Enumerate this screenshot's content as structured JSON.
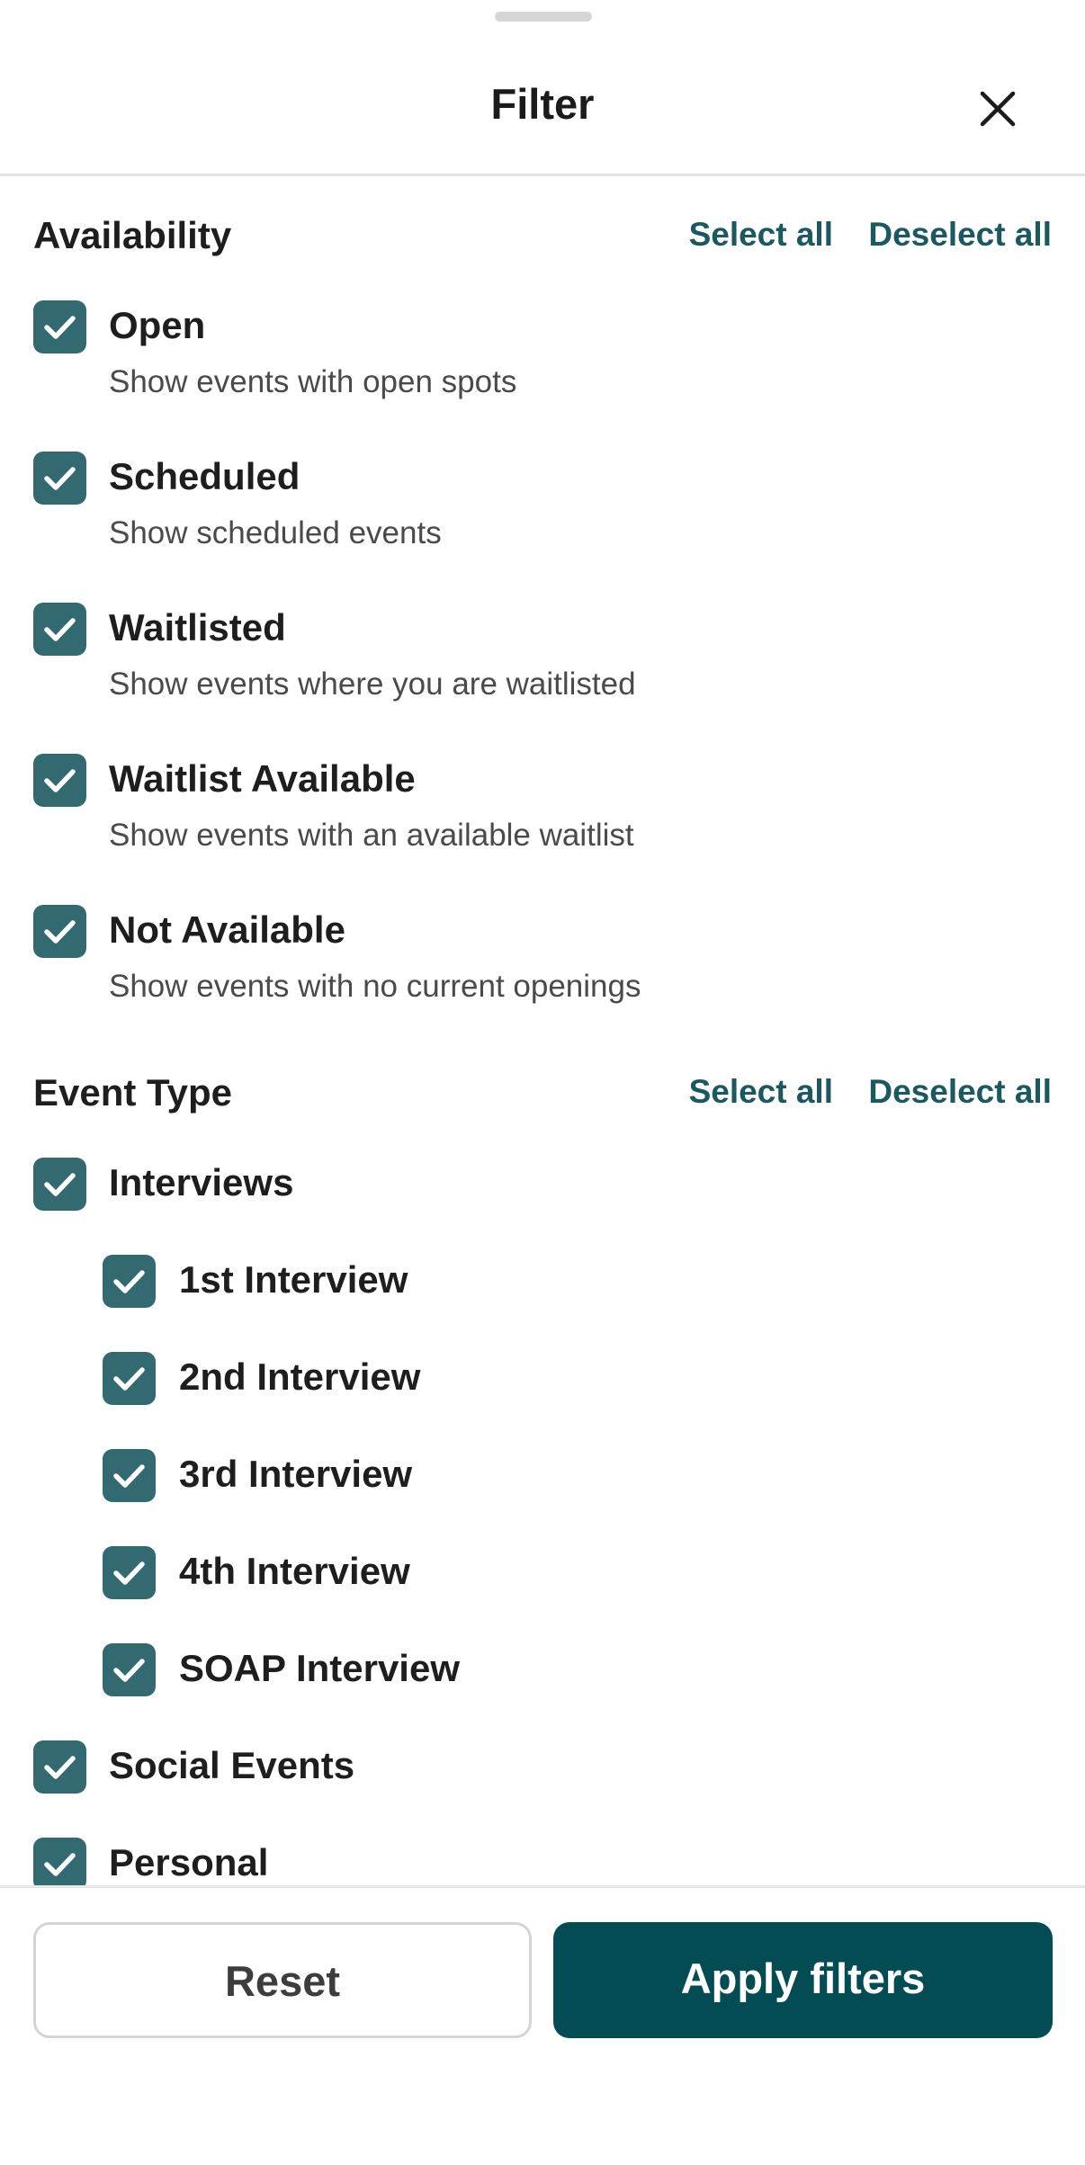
{
  "header": {
    "title": "Filter",
    "close_icon": "close-icon"
  },
  "availability": {
    "title": "Availability",
    "select_all": "Select all",
    "deselect_all": "Deselect all",
    "options": [
      {
        "label": "Open",
        "description": "Show events with open spots",
        "checked": true
      },
      {
        "label": "Scheduled",
        "description": "Show scheduled events",
        "checked": true
      },
      {
        "label": "Waitlisted",
        "description": "Show events where you are waitlisted",
        "checked": true
      },
      {
        "label": "Waitlist Available",
        "description": "Show events with an available waitlist",
        "checked": true
      },
      {
        "label": "Not Available",
        "description": "Show events with no current openings",
        "checked": true
      }
    ]
  },
  "event_type": {
    "title": "Event Type",
    "select_all": "Select all",
    "deselect_all": "Deselect all",
    "options": [
      {
        "label": "Interviews",
        "checked": true
      },
      {
        "label": "1st Interview",
        "checked": true
      },
      {
        "label": "2nd Interview",
        "checked": true
      },
      {
        "label": "3rd Interview",
        "checked": true
      },
      {
        "label": "4th Interview",
        "checked": true
      },
      {
        "label": "SOAP Interview",
        "checked": true
      },
      {
        "label": "Social Events",
        "checked": true
      },
      {
        "label": "Personal",
        "checked": true
      }
    ]
  },
  "footer": {
    "reset_label": "Reset",
    "apply_label": "Apply filters"
  },
  "colors": {
    "accent": "#044c54",
    "checkbox": "#336a72",
    "link": "#1c5860"
  }
}
